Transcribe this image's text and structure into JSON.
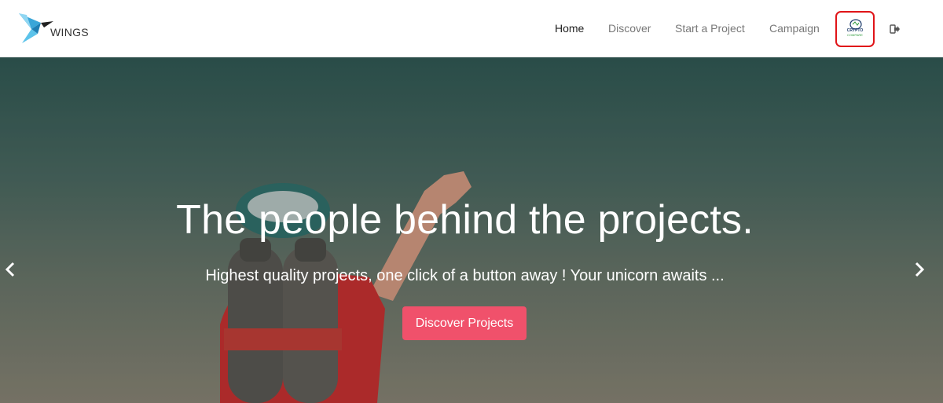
{
  "brand": {
    "name": "WINGS",
    "logo_icon": "wings-bird-icon"
  },
  "nav": {
    "items": [
      {
        "label": "Home",
        "active": true
      },
      {
        "label": "Discover",
        "active": false
      },
      {
        "label": "Start a Project",
        "active": false
      },
      {
        "label": "Campaign",
        "active": false
      }
    ],
    "crypto": {
      "line1": "CRYPTO",
      "line2": "COMPARE",
      "highlight_color": "#e01418"
    },
    "signout_icon": "sign-out-icon"
  },
  "hero": {
    "title": "The people behind the projects.",
    "subtitle": "Highest quality projects, one click of a button away ! Your unicorn awaits ...",
    "button_label": "Discover Projects",
    "button_color": "#f0516b",
    "prev_icon": "chevron-left-icon",
    "next_icon": "chevron-right-icon"
  }
}
